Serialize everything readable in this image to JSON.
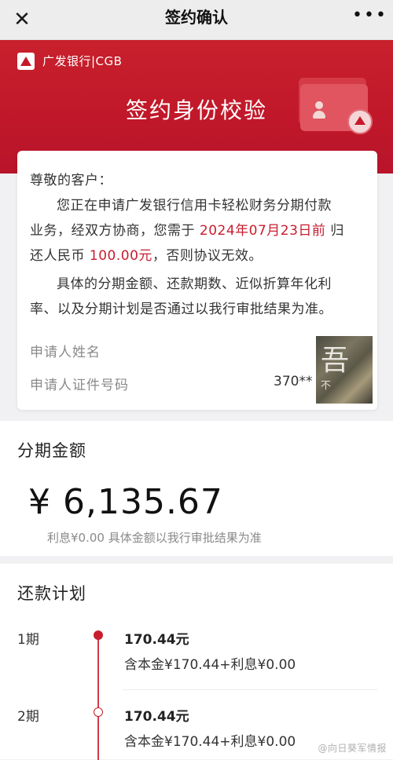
{
  "topbar": {
    "close_glyph": "✕",
    "title": "签约确认",
    "more_glyph": "•••"
  },
  "banner": {
    "bank_name": "广发银行|CGB",
    "title": "签约身份校验"
  },
  "notice": {
    "greeting": "尊敬的客户：",
    "line1": "您正在申请广发银行信用卡轻松财务分期付款",
    "line2_a": "业务，经双方协商，您需于 ",
    "line2_date": "2024年07月23日前",
    "line2_b": " 归",
    "line3_a": "还人民币 ",
    "line3_amount": "100.00元",
    "line3_b": "，否则协议无效。",
    "line4": "具体的分期金额、还款期数、近似折算年化利",
    "line5": "率、以及分期计划是否通过以我行审批结果为准。",
    "applicant_name_label": "申请人姓名",
    "applicant_id_label": "申请人证件号码",
    "applicant_id_value": "370**",
    "photo_glyph": "吾",
    "photo_glyph2": "不"
  },
  "installment": {
    "heading": "分期金额",
    "amount": "¥ 6,135.67",
    "note": "利息¥0.00 具体金额以我行审批结果为准"
  },
  "plan": {
    "heading": "还款计划",
    "items": [
      {
        "period": "1期",
        "amount": "170.44元",
        "detail": "含本金¥170.44+利息¥0.00"
      },
      {
        "period": "2期",
        "amount": "170.44元",
        "detail": "含本金¥170.44+利息¥0.00"
      }
    ]
  },
  "watermark": "@向日葵军情报",
  "colors": {
    "brand_red": "#c81d2f",
    "banner_red": "#c0182a"
  }
}
